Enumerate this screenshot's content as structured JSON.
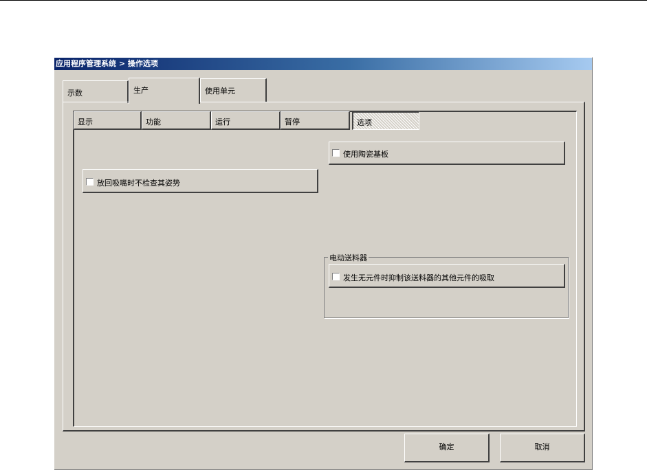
{
  "window": {
    "title": "应用程序管理系统 > 操作选项"
  },
  "main_tabs": [
    {
      "label": "示数"
    },
    {
      "label": "生产"
    },
    {
      "label": "使用单元"
    }
  ],
  "sub_tabs": [
    {
      "label": "显示"
    },
    {
      "label": "功能"
    },
    {
      "label": "运行"
    },
    {
      "label": "暂停"
    },
    {
      "label": "选项"
    }
  ],
  "options": {
    "ceramic_board": {
      "label": "使用陶瓷基板",
      "checked": false
    },
    "no_check_posture": {
      "label": "放回吸嘴时不检查其姿势",
      "checked": false
    }
  },
  "electric_feeder": {
    "group_label": "电动送料器",
    "suppress_pickup": {
      "label": "发生无元件时抑制该送料器的其他元件的吸取",
      "checked": false
    }
  },
  "buttons": {
    "ok": "确定",
    "cancel": "取消"
  }
}
